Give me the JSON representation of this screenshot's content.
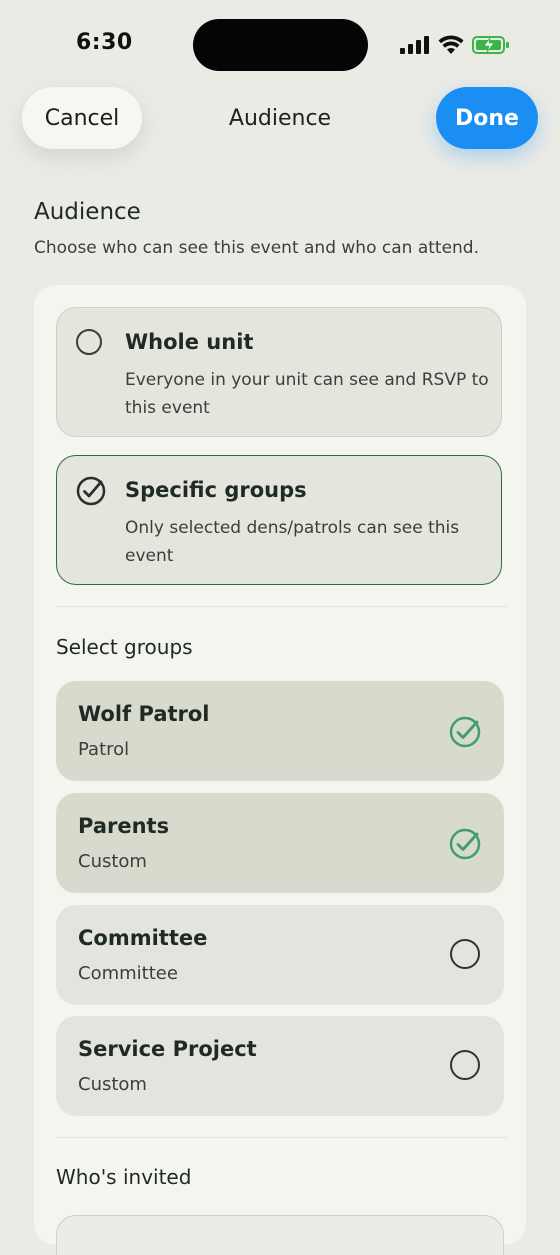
{
  "status_bar": {
    "time": "6:30",
    "icons": [
      "signal-icon",
      "wifi-icon",
      "battery-charging-icon"
    ]
  },
  "nav": {
    "cancel_label": "Cancel",
    "title": "Audience",
    "done_label": "Done"
  },
  "section": {
    "heading": "Audience",
    "description": "Choose who can see this event and who can attend."
  },
  "audience_options": [
    {
      "title": "Whole unit",
      "description": "Everyone in your unit can see and RSVP to this event",
      "selected": false
    },
    {
      "title": "Specific groups",
      "description": "Only selected dens/patrols can see this event",
      "selected": true
    }
  ],
  "select_groups": {
    "heading": "Select groups",
    "groups": [
      {
        "name": "Wolf Patrol",
        "type": "Patrol",
        "selected": true
      },
      {
        "name": "Parents",
        "type": "Custom",
        "selected": true
      },
      {
        "name": "Committee",
        "type": "Committee",
        "selected": false
      },
      {
        "name": "Service Project",
        "type": "Custom",
        "selected": false
      }
    ]
  },
  "invited": {
    "heading": "Who's invited"
  },
  "colors": {
    "background": "#ebebe6",
    "accent_blue": "#1a8ef2",
    "selected_border": "#2e6b44",
    "check_green": "#3f9e6a",
    "selected_row": "#d9dace"
  }
}
